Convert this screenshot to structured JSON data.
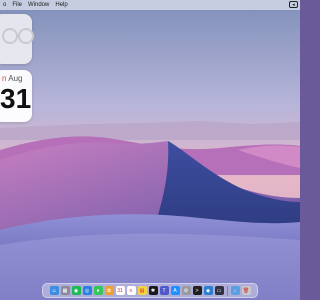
{
  "menubar": {
    "items": [
      "o",
      "File",
      "Window",
      "Help"
    ]
  },
  "calendar_widget": {
    "weekday_fragment": "n",
    "month": "Aug",
    "day": "31"
  },
  "dock": {
    "apps": [
      {
        "name": "finder-icon",
        "color": "#3a8de0",
        "glyph": "☺"
      },
      {
        "name": "launchpad-icon",
        "color": "#8a8a9a",
        "glyph": "▦"
      },
      {
        "name": "spotify-icon",
        "color": "#1db954",
        "glyph": "◉"
      },
      {
        "name": "safari-icon",
        "color": "#2a7fe0",
        "glyph": "◎"
      },
      {
        "name": "messages-icon",
        "color": "#35c759",
        "glyph": "●"
      },
      {
        "name": "photos-icon",
        "color": "#f0a030",
        "glyph": "✿"
      },
      {
        "name": "calendar-icon",
        "color": "#ffffff",
        "glyph": "31"
      },
      {
        "name": "reminders-icon",
        "color": "#ffffff",
        "glyph": "≡"
      },
      {
        "name": "notes-icon",
        "color": "#f5d33c",
        "glyph": "▤"
      },
      {
        "name": "chatgpt-icon",
        "color": "#1a1a1a",
        "glyph": "✱"
      },
      {
        "name": "teams-icon",
        "color": "#5059c9",
        "glyph": "T"
      },
      {
        "name": "app-store-icon",
        "color": "#1e90ff",
        "glyph": "A"
      },
      {
        "name": "settings-icon",
        "color": "#9a9aa0",
        "glyph": "⚙"
      },
      {
        "name": "terminal-icon",
        "color": "#202020",
        "glyph": ">"
      },
      {
        "name": "vscode-icon",
        "color": "#2a7fd0",
        "glyph": "◆"
      },
      {
        "name": "screen-icon",
        "color": "#303040",
        "glyph": "▭"
      },
      {
        "name": "downloads-icon",
        "color": "#5aa0e0",
        "glyph": "↓"
      },
      {
        "name": "trash-icon",
        "color": "#c8c8cc",
        "glyph": "🗑"
      }
    ]
  }
}
